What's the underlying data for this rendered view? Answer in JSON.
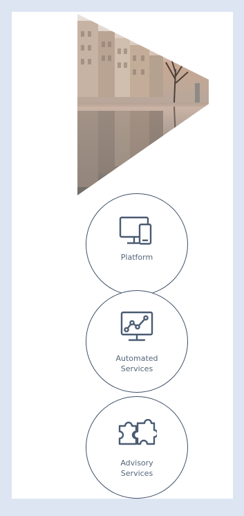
{
  "colors": {
    "background": "#dde5f3",
    "panel": "#ffffff",
    "circle_stroke": "#3f4f66",
    "icon_stroke": "#4a5b72",
    "label_text": "#55657a"
  },
  "hero": {
    "description_icon": "chevron-city-photo"
  },
  "items": [
    {
      "label": "Platform",
      "icon": "monitor-phone-icon"
    },
    {
      "label": "Automated\nServices",
      "label_line1": "Automated",
      "label_line2": "Services",
      "icon": "chart-monitor-icon"
    },
    {
      "label": "Advisory\nServices",
      "label_line1": "Advisory",
      "label_line2": "Services",
      "icon": "puzzle-icon"
    }
  ]
}
